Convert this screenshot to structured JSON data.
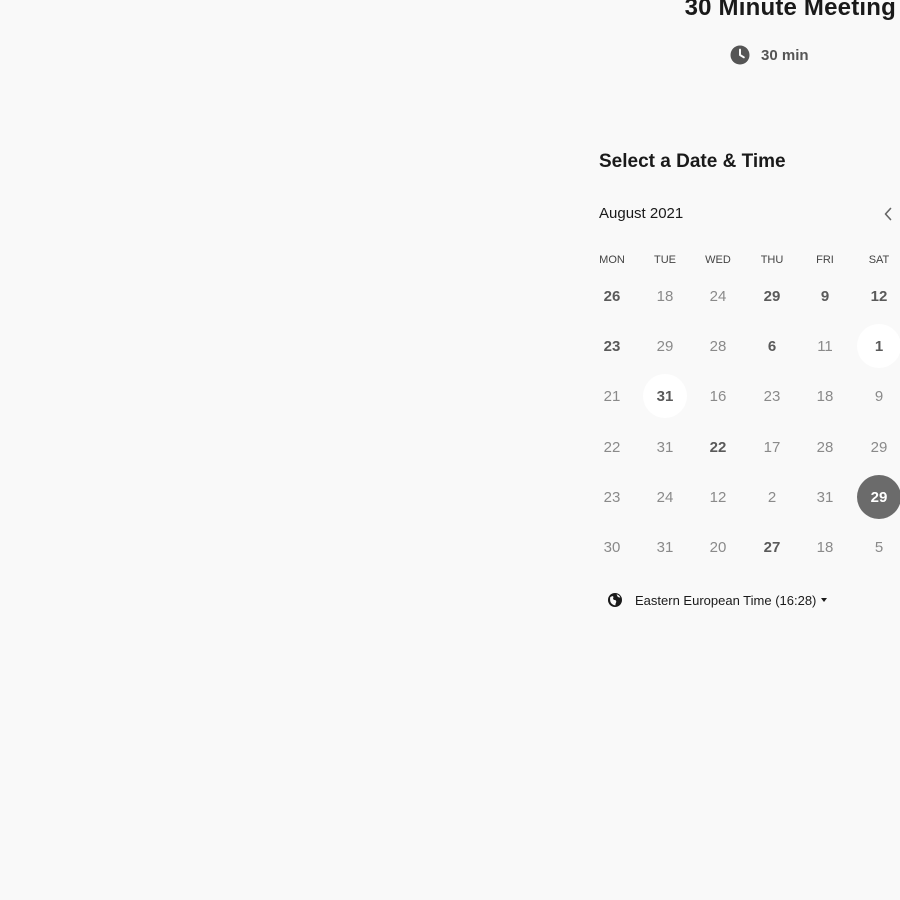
{
  "event": {
    "title": "30 Minute Meeting",
    "duration": "30 min"
  },
  "scheduler": {
    "heading": "Select a Date & Time",
    "month_label": "August 2021",
    "weekdays": [
      "MON",
      "TUE",
      "WED",
      "THU",
      "FRI",
      "SAT"
    ],
    "weeks": [
      [
        {
          "label": "26",
          "available": true
        },
        {
          "label": "18",
          "available": false
        },
        {
          "label": "24",
          "available": false
        },
        {
          "label": "29",
          "available": true
        },
        {
          "label": "9",
          "available": true
        },
        {
          "label": "12",
          "available": true
        }
      ],
      [
        {
          "label": "23",
          "available": true
        },
        {
          "label": "29",
          "available": false
        },
        {
          "label": "28",
          "available": false
        },
        {
          "label": "6",
          "available": true
        },
        {
          "label": "11",
          "available": false
        },
        {
          "label": "1",
          "available": true,
          "highlighted": true
        }
      ],
      [
        {
          "label": "21",
          "available": false
        },
        {
          "label": "31",
          "available": true,
          "highlighted": true
        },
        {
          "label": "16",
          "available": false
        },
        {
          "label": "23",
          "available": false
        },
        {
          "label": "18",
          "available": false
        },
        {
          "label": "9",
          "available": false
        }
      ],
      [
        {
          "label": "22",
          "available": false
        },
        {
          "label": "31",
          "available": false
        },
        {
          "label": "22",
          "available": true
        },
        {
          "label": "17",
          "available": false
        },
        {
          "label": "28",
          "available": false
        },
        {
          "label": "29",
          "available": false
        }
      ],
      [
        {
          "label": "23",
          "available": false
        },
        {
          "label": "24",
          "available": false
        },
        {
          "label": "12",
          "available": false
        },
        {
          "label": "2",
          "available": false
        },
        {
          "label": "31",
          "available": false
        },
        {
          "label": "29",
          "available": true,
          "selected": true
        }
      ],
      [
        {
          "label": "30",
          "available": false
        },
        {
          "label": "31",
          "available": false
        },
        {
          "label": "20",
          "available": false
        },
        {
          "label": "27",
          "available": true
        },
        {
          "label": "18",
          "available": false
        },
        {
          "label": "5",
          "available": false
        }
      ]
    ],
    "timezone": {
      "label": "Eastern European Time (16:28)"
    }
  },
  "icons": {
    "duration": "clock-icon",
    "previous_month": "chevron-left-icon",
    "timezone": "globe-icon",
    "timezone_dropdown": "caret-down-icon"
  },
  "colors": {
    "background": "#f9f9f9",
    "text_primary": "#1a1a1a",
    "available_day": "#5a5a5a",
    "unavailable_day": "#8a8a8a",
    "selected_day_background": "#6b6b6b",
    "highlighted_day_background": "#ffffff"
  }
}
